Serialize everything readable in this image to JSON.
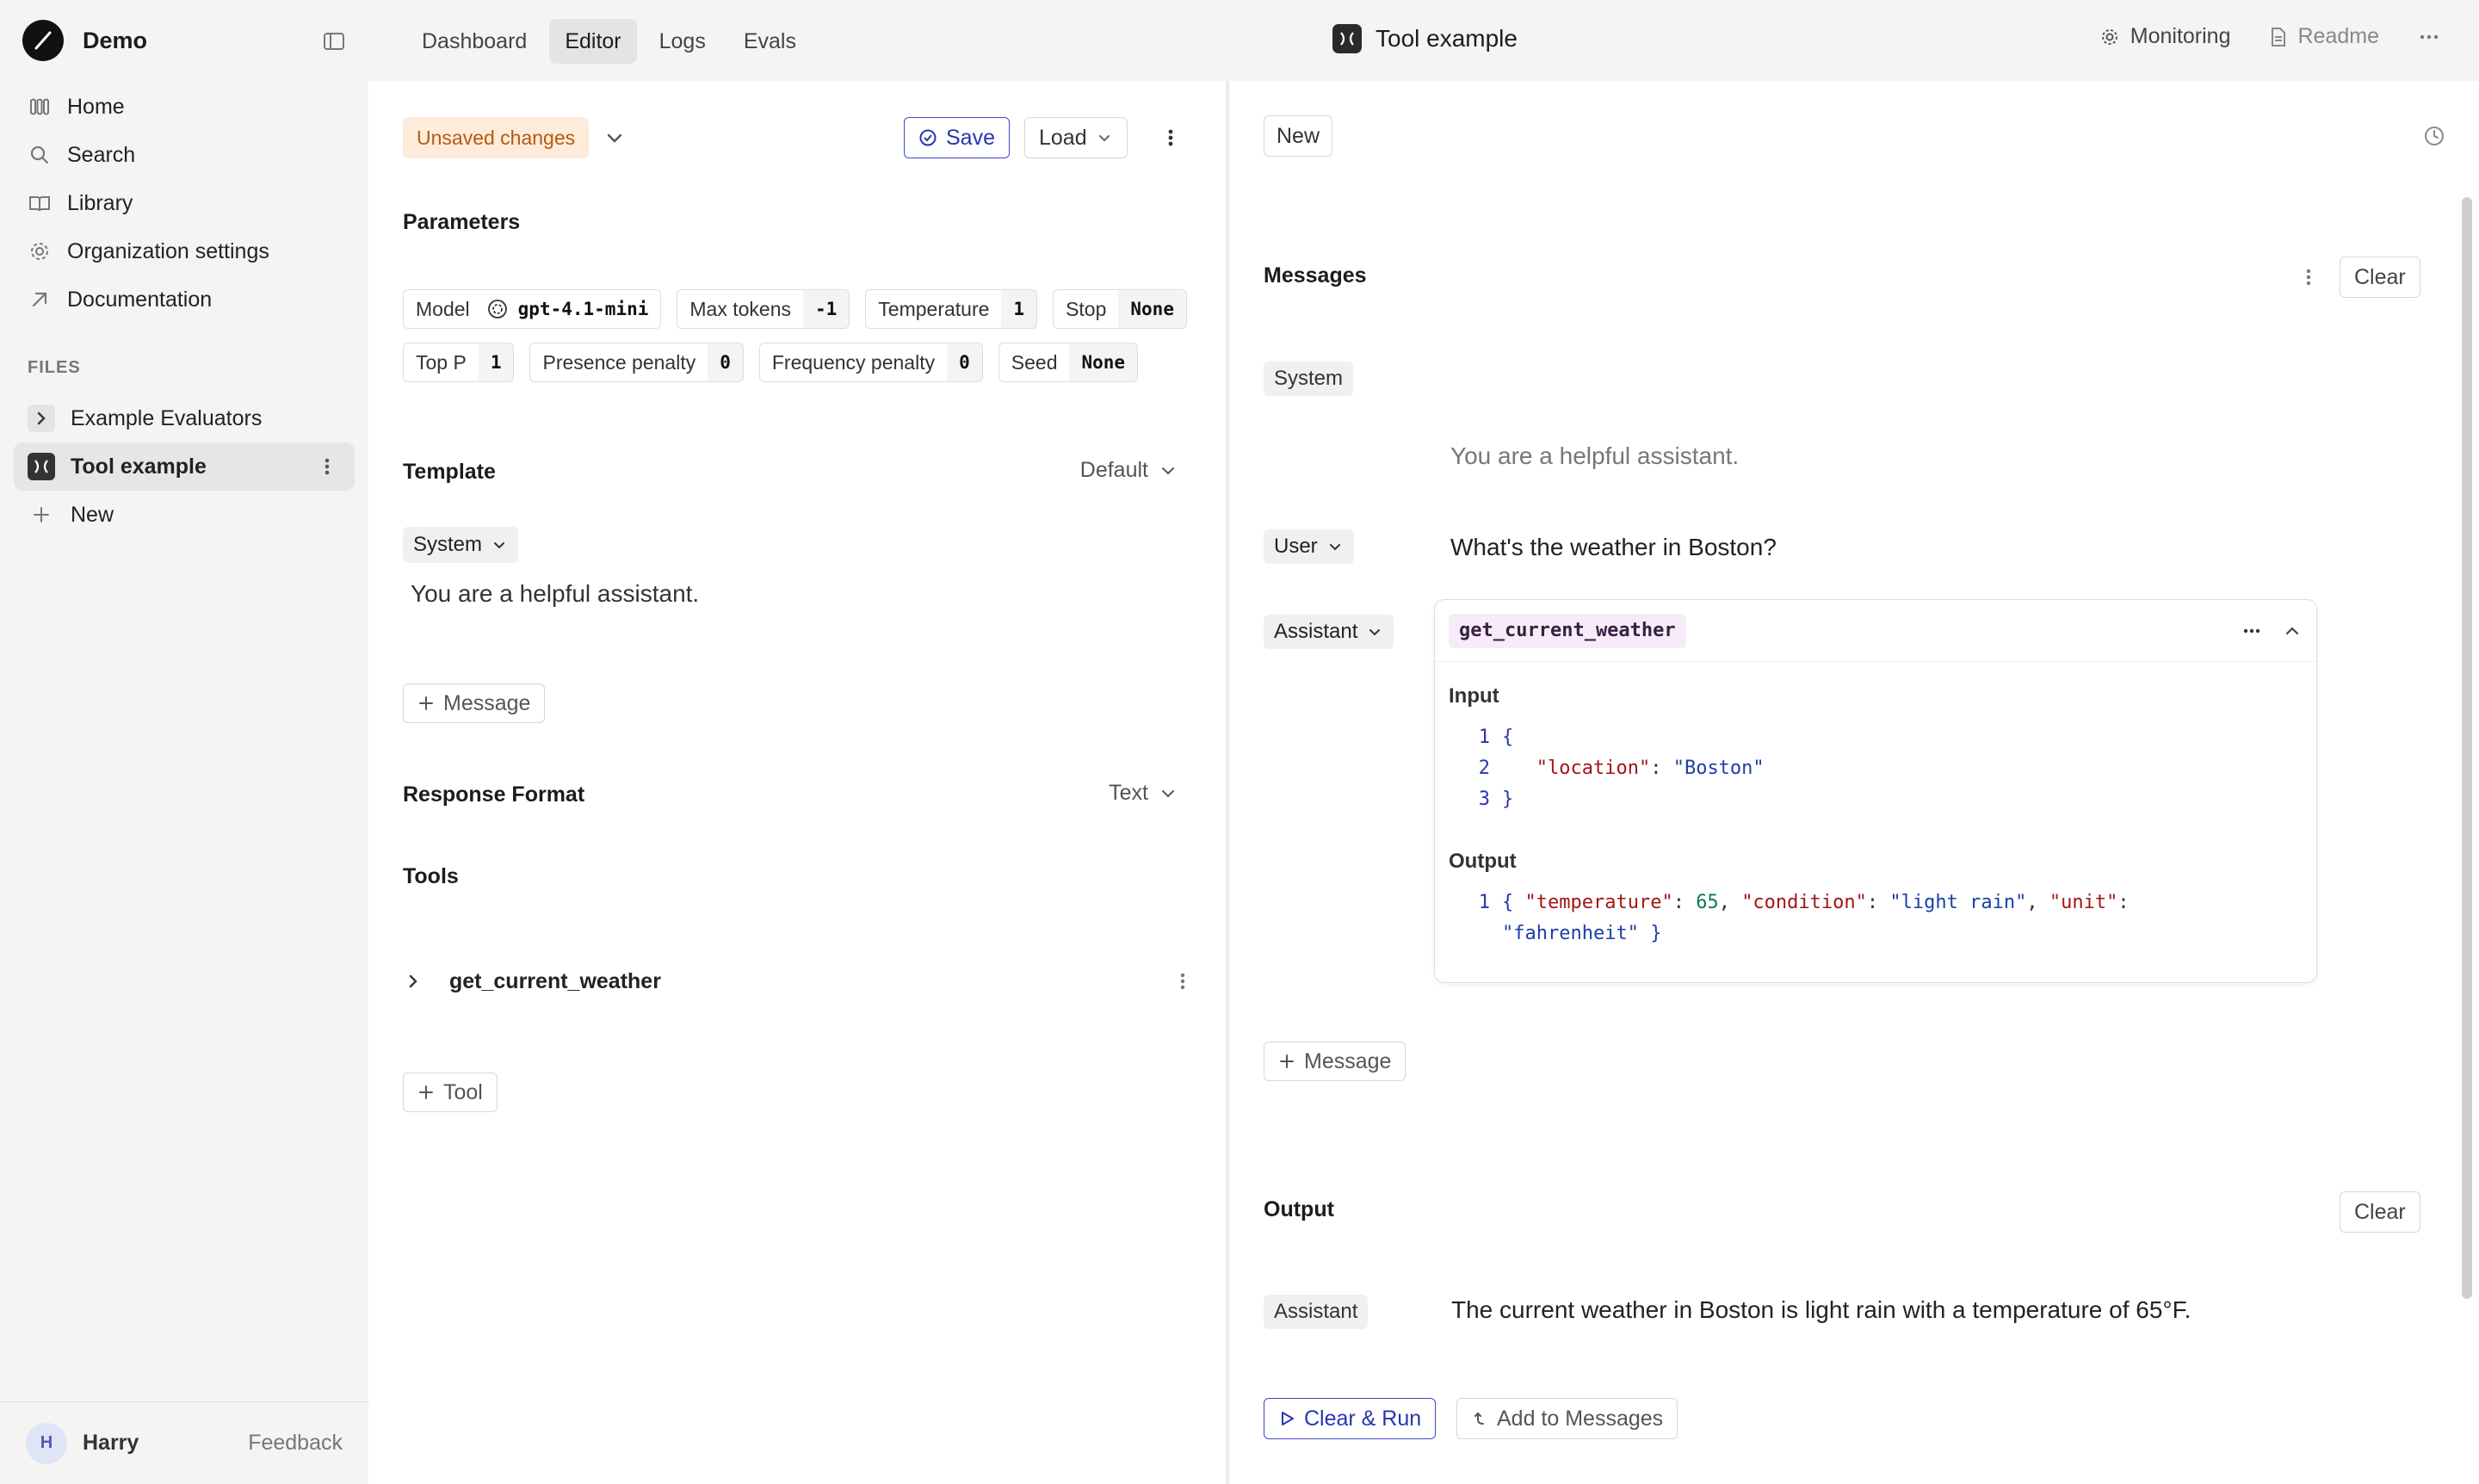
{
  "sidebar": {
    "org_name": "Demo",
    "nav": [
      {
        "label": "Home",
        "icon": "home-icon"
      },
      {
        "label": "Search",
        "icon": "search-icon"
      },
      {
        "label": "Library",
        "icon": "book-icon"
      },
      {
        "label": "Organization settings",
        "icon": "gear-icon"
      },
      {
        "label": "Documentation",
        "icon": "arrow-up-right-icon"
      }
    ],
    "files_heading": "FILES",
    "files": [
      {
        "label": "Example Evaluators"
      },
      {
        "label": "Tool example"
      },
      {
        "label": "New"
      }
    ],
    "user": {
      "initial": "H",
      "name": "Harry"
    },
    "feedback": "Feedback"
  },
  "topbar": {
    "tabs": [
      "Dashboard",
      "Editor",
      "Logs",
      "Evals"
    ],
    "active_tab": "Editor",
    "title": "Tool example",
    "monitoring": "Monitoring",
    "readme": "Readme"
  },
  "editor": {
    "status": "Unsaved changes",
    "save": "Save",
    "load": "Load",
    "parameters_title": "Parameters",
    "params": [
      {
        "key": "Model",
        "value": "gpt-4.1-mini"
      },
      {
        "key": "Max tokens",
        "value": "-1"
      },
      {
        "key": "Temperature",
        "value": "1"
      },
      {
        "key": "Stop",
        "value": "None"
      },
      {
        "key": "Top P",
        "value": "1"
      },
      {
        "key": "Presence penalty",
        "value": "0"
      },
      {
        "key": "Frequency penalty",
        "value": "0"
      },
      {
        "key": "Seed",
        "value": "None"
      }
    ],
    "template_title": "Template",
    "template_mode": "Default",
    "template_role": "System",
    "template_text": "You are a helpful assistant.",
    "add_message": "Message",
    "response_format_title": "Response Format",
    "response_format_value": "Text",
    "tools_title": "Tools",
    "tool_name": "get_current_weather",
    "add_tool": "Tool"
  },
  "playground": {
    "new": "New",
    "messages_title": "Messages",
    "clear": "Clear",
    "system_role": "System",
    "system_text": "You are a helpful assistant.",
    "user_role": "User",
    "user_text": "What's the weather in Boston?",
    "assistant_role": "Assistant",
    "tool_call": {
      "name": "get_current_weather",
      "input_label": "Input",
      "output_label": "Output"
    },
    "add_message": "Message",
    "output_title": "Output",
    "output_clear": "Clear",
    "output_role": "Assistant",
    "output_text": "The current weather in Boston is light rain with a temperature of 65°F.",
    "clear_run": "Clear & Run",
    "add_to_messages": "Add to Messages"
  },
  "colors": {
    "accent": "#2a35b0",
    "warning_bg": "#fdecd9",
    "warning_text": "#b35a12"
  }
}
